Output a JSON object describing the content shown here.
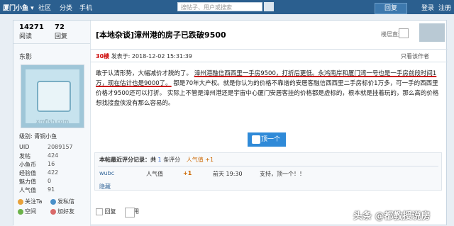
{
  "topbar": {
    "site": "厦门小鱼 ▾",
    "links": [
      "社区",
      "分类",
      "手机"
    ],
    "search_placeholder": "搜帖子、用户或搜索",
    "reply_label": "回复",
    "login": "登录",
    "register": "注册"
  },
  "author": {
    "views_count": "14271",
    "views_label": "阅读",
    "replies_count": "72",
    "replies_label": "回复",
    "name": "东影",
    "avatar_watermark": "xmfish.com",
    "level": "级别: 青铜小鱼",
    "stats": [
      {
        "k": "UID",
        "v": "2089157"
      },
      {
        "k": "发帖",
        "v": "424"
      },
      {
        "k": "小鱼币",
        "v": "16"
      },
      {
        "k": "经验值",
        "v": "422"
      },
      {
        "k": "魅力值",
        "v": "0"
      },
      {
        "k": "人气值",
        "v": "91"
      }
    ],
    "actions": [
      "关注Ta",
      "发私信",
      "空间",
      "加好友"
    ]
  },
  "post": {
    "title": "[本地杂谈]漳州港的房子已跌破9500",
    "right_label": "楼层直达",
    "floor": "30楼",
    "posted": "发表于: 2018-12-02 15:31:39",
    "only_author": "只看该作者",
    "content_1": "敢于认清形势，大幅减价才脱的了。",
    "content_2": "漳州港融信西西里一手房9500，打折后更低。永鸿南岸和厦门湾一号也是一手房前段时间1万，现在估计也是9000了。",
    "content_3": "都是70年大产权。就是你认为的价格不靠谱的安居客融信西西里二手房标价1万多，可一手的西西里价格才9500还可以打折。 实际上不管是漳州港还是宇宙中心厦门安居客挂的价格都是虚标的，根本就是挂着玩的，那么高的价格想找接盘侠没有那么容易的。",
    "like_label": "顶一个",
    "rating_header": "本帖最近评分记录：共",
    "rating_count": "1",
    "rating_unit": "条评分",
    "rating_title": "人气值 +1",
    "rating_row": {
      "user": "wubc",
      "type": "人气值",
      "delta": "+1",
      "time": "前天 19:30",
      "reason": "支持，顶一个！！"
    },
    "hide_label": "隐藏",
    "footer_reply": "回复",
    "footer_quote": "引用"
  },
  "watermark": "头条 @都教授说房"
}
